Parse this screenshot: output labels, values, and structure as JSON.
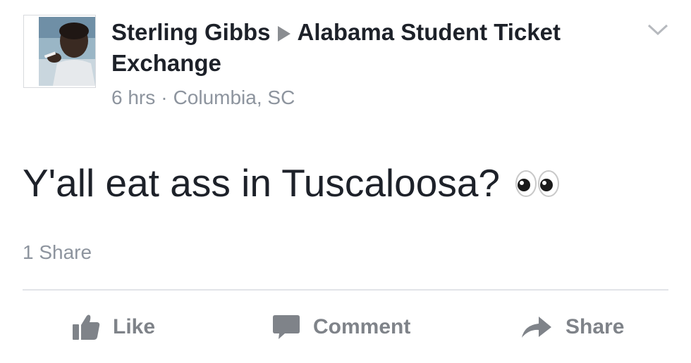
{
  "post": {
    "author": "Sterling Gibbs",
    "group": "Alabama Student Ticket Exchange",
    "time": "6 hrs",
    "separator": "·",
    "location": "Columbia, SC",
    "text": "Y'all eat ass in Tuscaloosa?",
    "emoji": "eyes-emoji",
    "shares": "1 Share"
  },
  "actions": {
    "like_label": "Like",
    "comment_label": "Comment",
    "share_label": "Share"
  },
  "colors": {
    "text": "#1d2129",
    "muted": "#8d949e",
    "action": "#7f8389",
    "divider": "#e2e4e8"
  }
}
